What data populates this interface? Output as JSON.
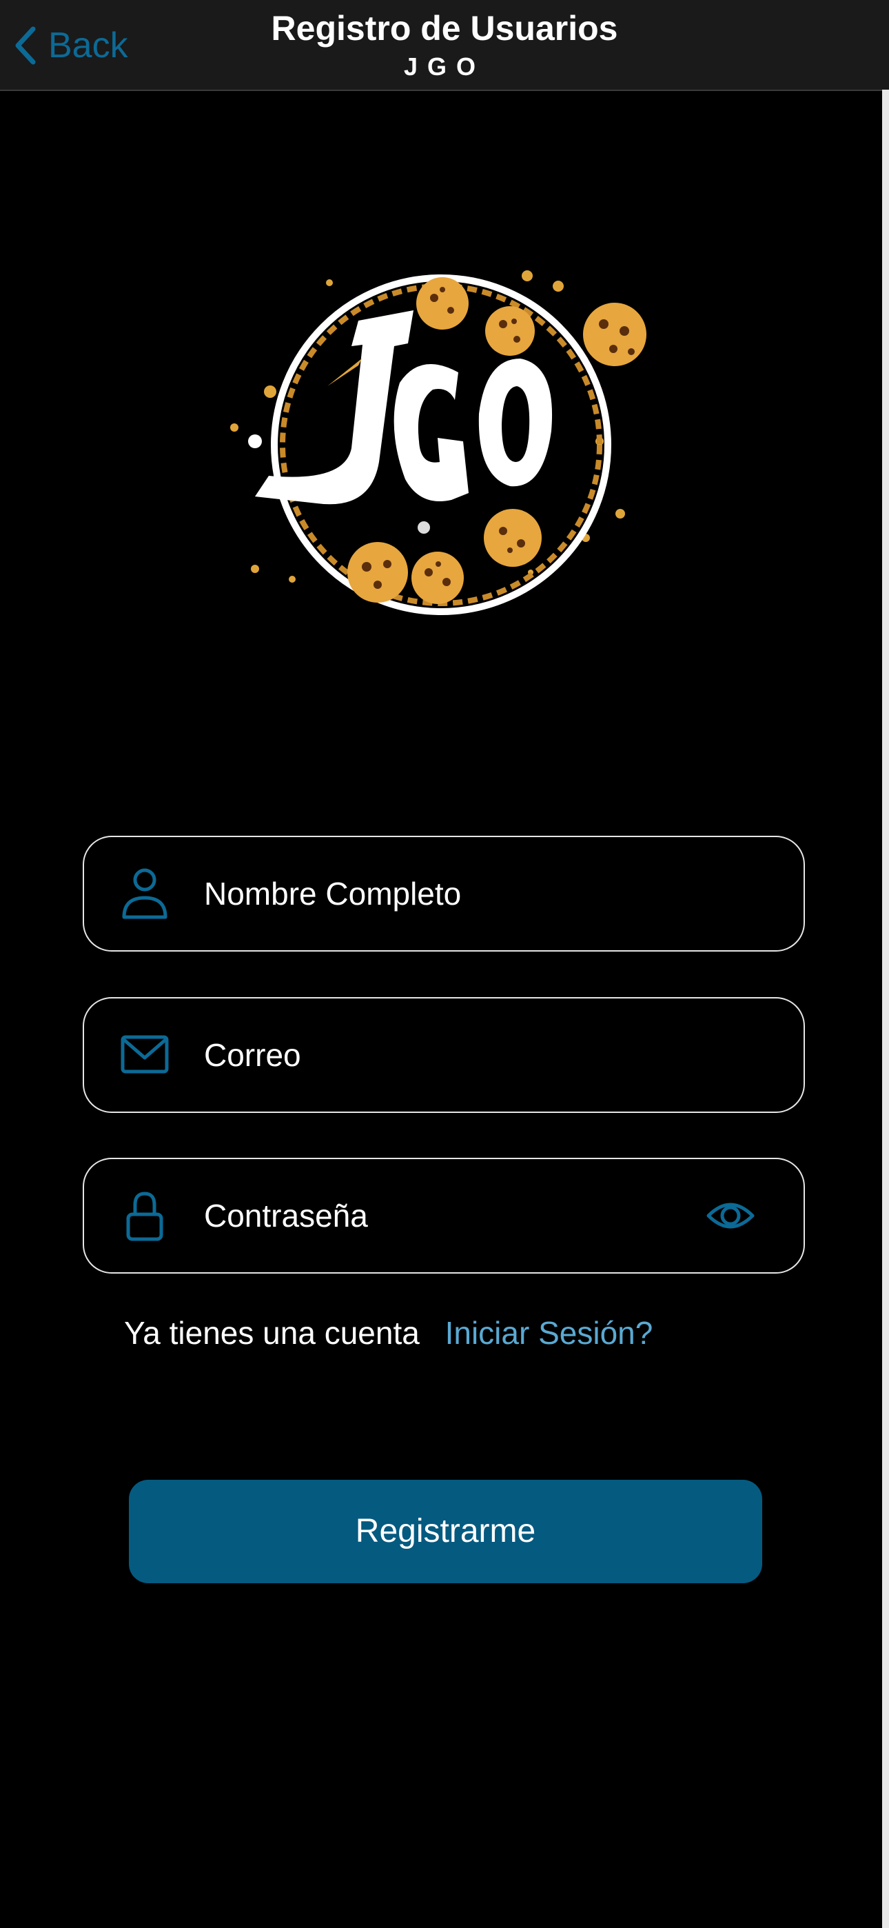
{
  "header": {
    "back_label": "Back",
    "title": "Registro de Usuarios",
    "subtitle": "JGO"
  },
  "logo": {
    "text": "JGO"
  },
  "form": {
    "name_placeholder": "Nombre Completo",
    "email_placeholder": "Correo",
    "password_placeholder": "Contraseña"
  },
  "login": {
    "prompt": "Ya tienes una cuenta",
    "link": "Iniciar Sesión?"
  },
  "register_button": "Registrarme",
  "icons": {
    "back": "chevron-left-icon",
    "name": "person-icon",
    "email": "envelope-icon",
    "password": "lock-icon",
    "toggle": "eye-icon"
  },
  "colors": {
    "accent": "#0c6a96",
    "button": "#055a80",
    "link": "#5aa9d2",
    "logo_gold": "#e0a53a"
  }
}
